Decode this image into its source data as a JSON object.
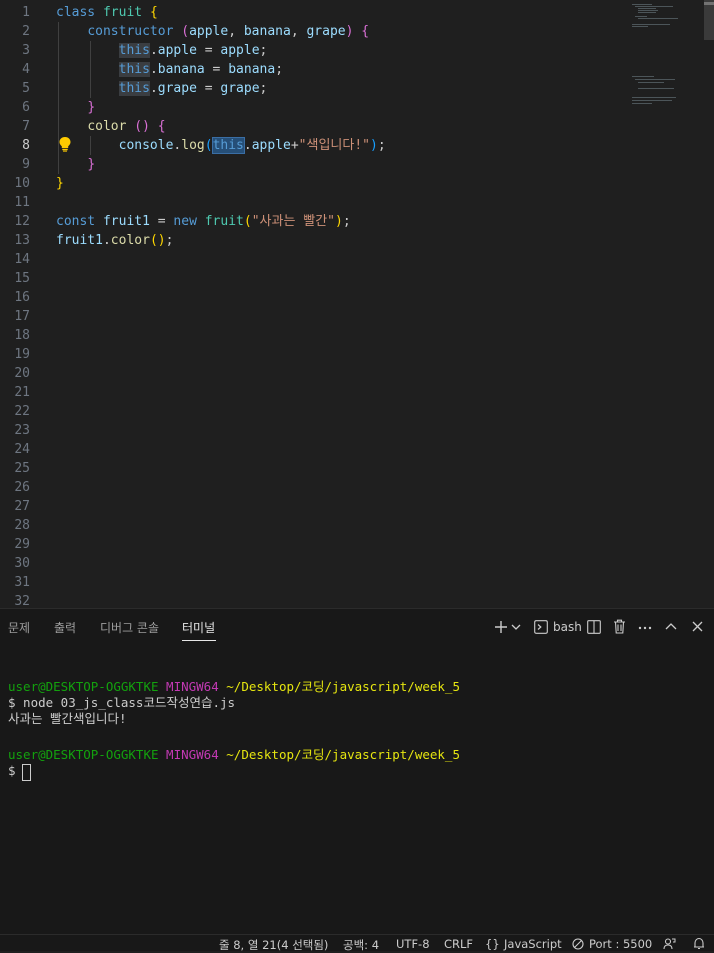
{
  "editor": {
    "line_numbers": [
      "1",
      "2",
      "3",
      "4",
      "5",
      "6",
      "7",
      "8",
      "9",
      "10",
      "11",
      "12",
      "13",
      "14",
      "15",
      "16",
      "17",
      "18",
      "19",
      "20",
      "21",
      "22",
      "23",
      "24",
      "25",
      "26",
      "27",
      "28",
      "29",
      "30",
      "31",
      "32"
    ],
    "active_line": "8",
    "tokens": {
      "class_kw": "class",
      "fruit": "fruit",
      "constructor": "constructor",
      "apple": "apple",
      "banana": "banana",
      "grape": "grape",
      "this": "this",
      "color": "color",
      "console": "console",
      "log": "log",
      "string_color": "\"색입니다!\"",
      "const_kw": "const",
      "fruit1": "fruit1",
      "new_kw": "new",
      "string_apple": "\"사과는 빨간\""
    }
  },
  "panel": {
    "tabs": [
      "문제",
      "출력",
      "디버그 콘솔",
      "터미널"
    ],
    "active_tab": "터미널",
    "shell": "bash",
    "terminal": {
      "user_host": "user@DESKTOP-OGGKTKE",
      "mingw": "MINGW64",
      "path": "~/Desktop/코딩/javascript/week_5",
      "command": "$ node 03_js_class코드작성연습.js",
      "output": "사과는 빨간색입니다!",
      "prompt": "$"
    }
  },
  "status_bar": {
    "position": "줄 8, 열 21(4 선택됨)",
    "spaces": "공백: 4",
    "encoding": "UTF-8",
    "eol": "CRLF",
    "language": "JavaScript",
    "port": "Port : 5500"
  },
  "icons": {
    "lightbulb": "lightbulb-icon",
    "new_terminal": "plus-icon",
    "dropdown": "chevron-down-icon",
    "bash": "terminal-icon",
    "split": "split-icon",
    "trash": "trash-icon",
    "more": "ellipsis-icon",
    "maximize": "chevron-up-icon",
    "close": "close-icon",
    "language_braces": "braces-icon",
    "port": "broadcast-icon",
    "feedback": "feedback-icon",
    "bell": "bell-icon"
  },
  "colors": {
    "keyword": "#569cd6",
    "class_name": "#4ec9b0",
    "function": "#dcdcaa",
    "string": "#ce9178",
    "terminal_green": "#13a10e",
    "terminal_magenta": "#c239b3",
    "terminal_yellow": "#e5e510"
  }
}
